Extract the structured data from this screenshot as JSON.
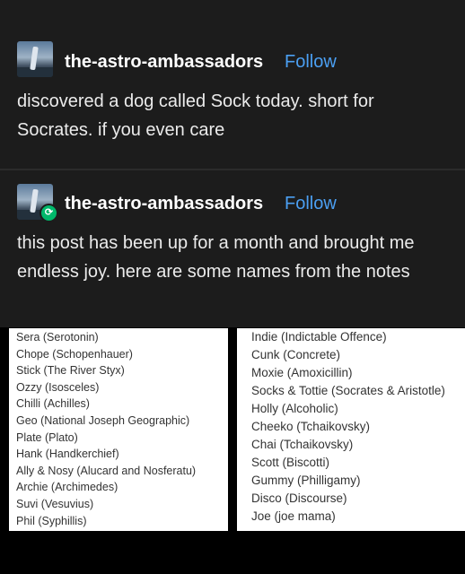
{
  "posts": [
    {
      "username": "the-astro-ambassadors",
      "follow_label": "Follow",
      "text": "discovered a dog called Sock today. short for Socrates. if you even care"
    },
    {
      "username": "the-astro-ambassadors",
      "follow_label": "Follow",
      "text": "this post has been up for a month and brought me endless joy. here are some names from the notes"
    }
  ],
  "reblog_icon": "reblog-icon",
  "left_list": [
    "Sera (Serotonin)",
    "Chope (Schopenhauer)",
    "Stick (The River Styx)",
    "Ozzy (Isosceles)",
    "Chilli (Achilles)",
    "Geo (National Joseph Geographic)",
    "Plate (Plato)",
    "Hank (Handkerchief)",
    "Ally & Nosy (Alucard and Nosferatu)",
    "Archie (Archimedes)",
    "Suvi (Vesuvius)",
    "Phil (Syphillis)"
  ],
  "right_list": [
    "Indie (Indictable Offence)",
    "Cunk (Concrete)",
    "Moxie (Amoxicillin)",
    "Socks & Tottie (Socrates & Aristotle)",
    "Holly (Alcoholic)",
    "Cheeko (Tchaikovsky)",
    "Chai (Tchaikovsky)",
    "Scott (Biscotti)",
    "Gummy (Philligamy)",
    "Disco (Discourse)",
    "Joe (joe mama)"
  ],
  "colors": {
    "background": "#1c1c1c",
    "follow": "#4b9ff2",
    "reblog": "#00b86b"
  }
}
